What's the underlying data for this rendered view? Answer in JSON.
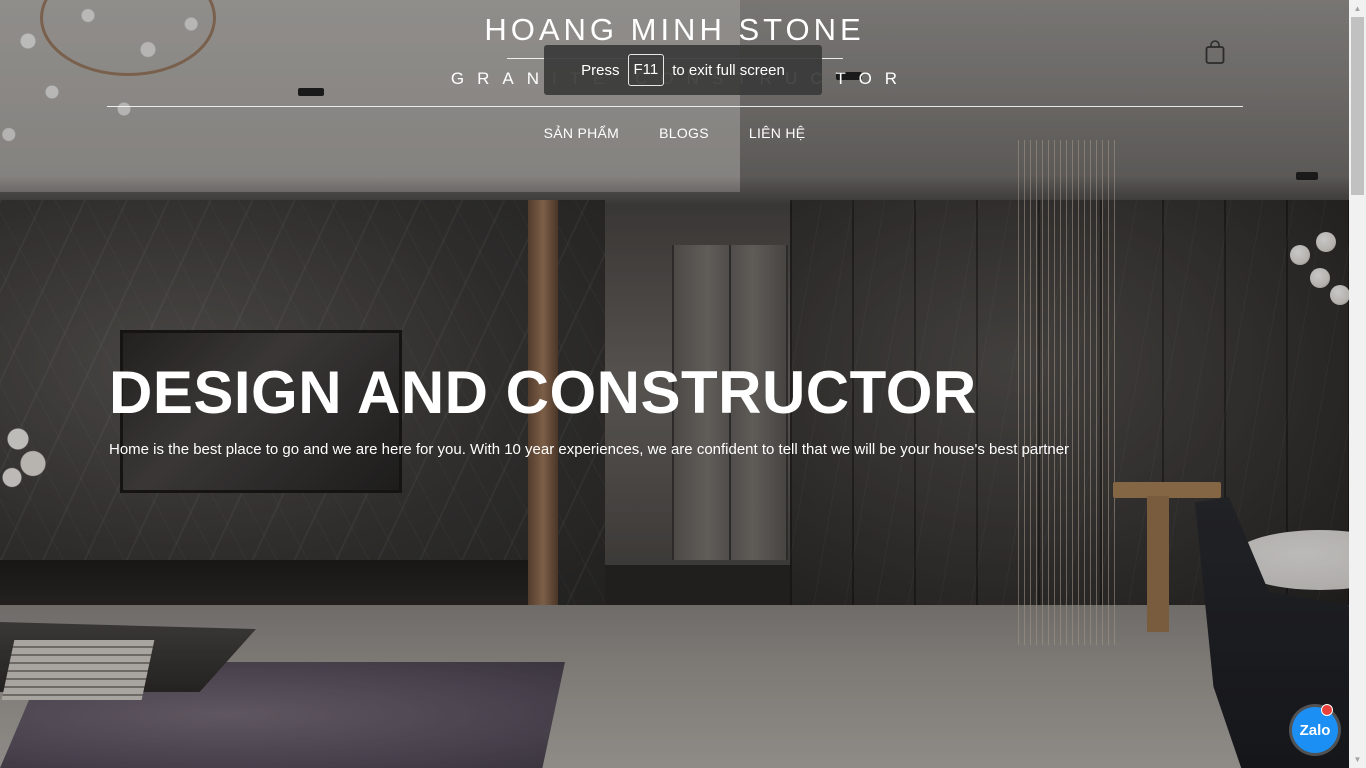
{
  "brand": {
    "title": "HOANG MINH STONE",
    "subtitle": "GRANITE CONSTRUCTOR"
  },
  "nav": {
    "items": [
      {
        "label": "SẢN PHẨM"
      },
      {
        "label": "BLOGS"
      },
      {
        "label": "LIÊN HỆ"
      }
    ]
  },
  "header": {
    "cart_icon": "shopping-bag-icon"
  },
  "hero": {
    "title": "DESIGN AND CONSTRUCTOR",
    "text": "Home is the best place to go and we are here for you. With 10 year experiences, we are confident to tell that we will be your house's best partner"
  },
  "fullscreen_toast": {
    "prefix": "Press",
    "key": "F11",
    "suffix": "to exit full screen"
  },
  "zalo": {
    "label": "Zalo",
    "color": "#1b8ff3",
    "badge_color": "#e8403a"
  },
  "colors": {
    "text": "#ffffff",
    "toast_bg": "#3a3a3a"
  }
}
